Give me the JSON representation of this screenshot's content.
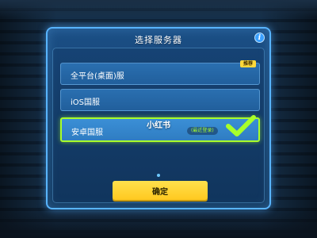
{
  "dialog": {
    "title": "选择服务器",
    "info_icon": "i"
  },
  "servers": [
    {
      "label": "全平台(桌面)服",
      "badge": "推荐",
      "selected": false
    },
    {
      "label": "iOS国服",
      "selected": false
    },
    {
      "label": "安卓国服",
      "status": "(最近登录)",
      "selected": true
    }
  ],
  "watermark": "小红书",
  "confirm_label": "确定",
  "colors": {
    "panel_border": "#58b4ff",
    "selected_border": "#a8ff2a",
    "confirm_button": "#ffd83a"
  }
}
